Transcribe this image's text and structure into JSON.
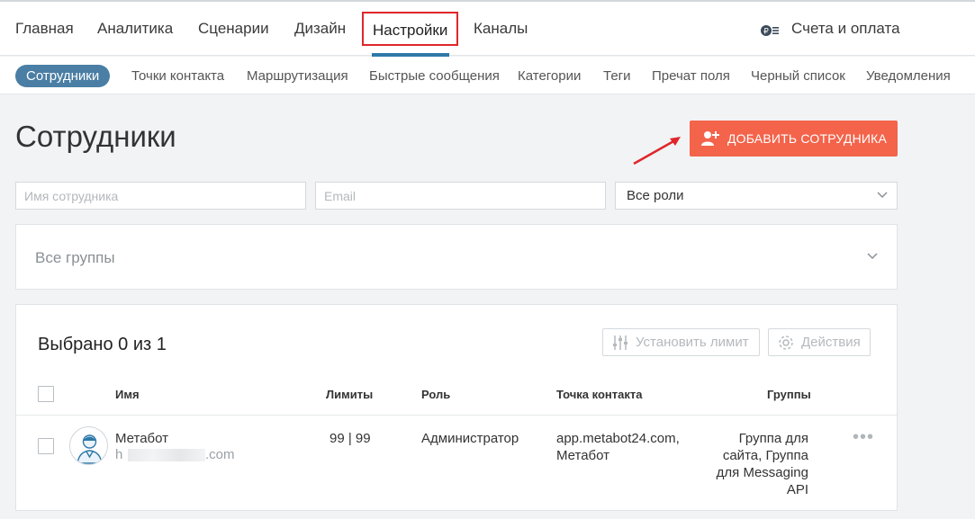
{
  "top_nav": {
    "items": [
      {
        "label": "Главная"
      },
      {
        "label": "Аналитика"
      },
      {
        "label": "Сценарии"
      },
      {
        "label": "Дизайн"
      },
      {
        "label": "Настройки",
        "active": true
      },
      {
        "label": "Каналы"
      }
    ],
    "billing_label": "Счета и оплата"
  },
  "sub_nav": {
    "items": [
      {
        "label": "Сотрудники",
        "active": true
      },
      {
        "label": "Точки контакта"
      },
      {
        "label": "Маршрутизация"
      },
      {
        "label": "Быстрые сообщения"
      },
      {
        "label": "Категории"
      },
      {
        "label": "Теги"
      },
      {
        "label": "Пречат поля"
      },
      {
        "label": "Черный список"
      },
      {
        "label": "Уведомления"
      }
    ]
  },
  "page": {
    "title": "Сотрудники",
    "add_button_label": "ДОБАВИТЬ СОТРУДНИКА"
  },
  "filters": {
    "name_placeholder": "Имя сотрудника",
    "email_placeholder": "Email",
    "role_value": "Все роли",
    "groups_value": "Все группы"
  },
  "table": {
    "selected_text": "Выбрано 0 из 1",
    "set_limit_label": "Установить лимит",
    "actions_label": "Действия",
    "columns": {
      "name": "Имя",
      "limits": "Лимиты",
      "role": "Роль",
      "contact_point": "Точка контакта",
      "groups": "Группы"
    },
    "rows": [
      {
        "name": "Метабот",
        "email_start": "h",
        "email_end": ".com",
        "limits": "99 | 99",
        "role": "Администратор",
        "contact_point_line1": "app.metabot24.com,",
        "contact_point_line2": "Метабот",
        "groups_line1": "Группа для",
        "groups_line2": "сайта, Группа",
        "groups_line3": "для Messaging",
        "groups_line4": "API"
      }
    ]
  },
  "colors": {
    "accent_blue": "#2d79a8",
    "active_pill": "#4a7ea4",
    "add_button": "#f3644b",
    "highlight_red": "#e0262b"
  },
  "icons": [
    "billing-icon",
    "add-user-icon",
    "chevron-down-icon",
    "sliders-icon",
    "gear-icon",
    "user-avatar-icon",
    "more-dots-icon",
    "annotation-arrow"
  ]
}
